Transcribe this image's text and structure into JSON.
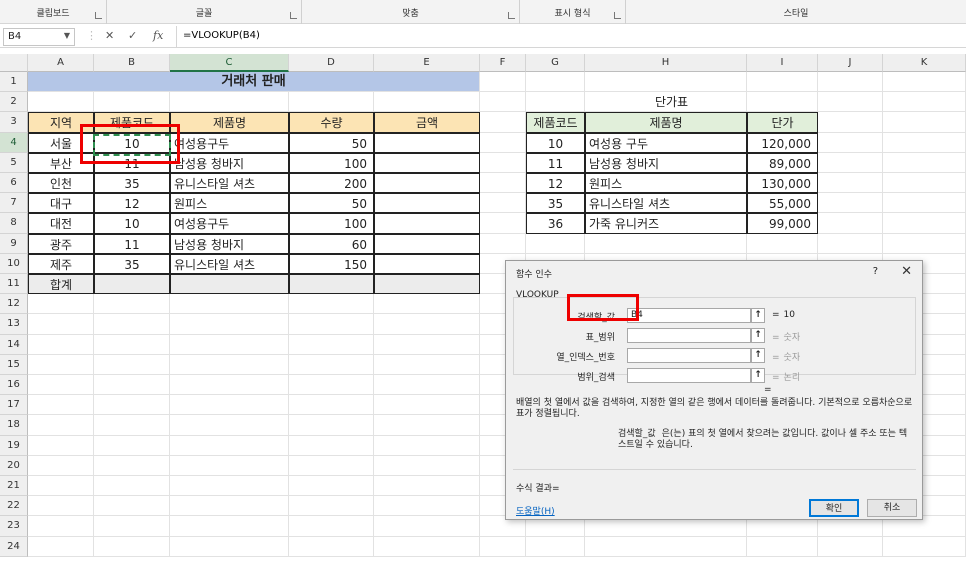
{
  "ribbon": {
    "groups": [
      "클립보드",
      "글꼴",
      "맞춤",
      "표시 형식",
      "스타일"
    ]
  },
  "formula_bar": {
    "name_box": "B4",
    "cancel": "✕",
    "enter": "✓",
    "fx": "fx",
    "formula": "=VLOOKUP(B4)"
  },
  "columns": [
    "A",
    "B",
    "C",
    "D",
    "E",
    "F",
    "G",
    "H",
    "I",
    "J",
    "K"
  ],
  "rows": [
    "1",
    "2",
    "3",
    "4",
    "5",
    "6",
    "7",
    "8",
    "9",
    "10",
    "11",
    "12",
    "13",
    "14",
    "15",
    "16",
    "17",
    "18",
    "19",
    "20",
    "21",
    "22",
    "23",
    "24"
  ],
  "sheet": {
    "title": "거래처 판매",
    "headers": [
      "지역",
      "제품코드",
      "제품명",
      "수량",
      "금액"
    ],
    "data": [
      {
        "region": "서울",
        "code": "10",
        "name": "여성용구두",
        "qty": "50"
      },
      {
        "region": "부산",
        "code": "11",
        "name": "남성용 청바지",
        "qty": "100"
      },
      {
        "region": "인천",
        "code": "35",
        "name": "유니스타일 셔츠",
        "qty": "200"
      },
      {
        "region": "대구",
        "code": "12",
        "name": "원피스",
        "qty": "50"
      },
      {
        "region": "대전",
        "code": "10",
        "name": "여성용구두",
        "qty": "100"
      },
      {
        "region": "광주",
        "code": "11",
        "name": "남성용 청바지",
        "qty": "60"
      },
      {
        "region": "제주",
        "code": "35",
        "name": "유니스타일 셔츠",
        "qty": "150"
      }
    ],
    "total_label": "합계"
  },
  "price_table": {
    "title": "단가표",
    "headers": [
      "제품코드",
      "제품명",
      "단가"
    ],
    "data": [
      {
        "code": "10",
        "name": "여성용 구두",
        "price": "120,000"
      },
      {
        "code": "11",
        "name": "남성용 청바지",
        "price": "89,000"
      },
      {
        "code": "12",
        "name": "원피스",
        "price": "130,000"
      },
      {
        "code": "35",
        "name": "유니스타일 셔츠",
        "price": "55,000"
      },
      {
        "code": "36",
        "name": "가죽 유니커즈",
        "price": "99,000"
      }
    ]
  },
  "dialog": {
    "title": "함수 인수",
    "help_glyph": "?",
    "close_glyph": "✕",
    "function_name": "VLOOKUP",
    "args": [
      {
        "label": "검색할_값",
        "value": "B4",
        "result": "10"
      },
      {
        "label": "표_범위",
        "value": "",
        "result": "숫자"
      },
      {
        "label": "열_인덱스_번호",
        "value": "",
        "result": "숫자"
      },
      {
        "label": "범위_검색",
        "value": "",
        "result": "논리"
      }
    ],
    "ref_button": "↑",
    "eq_sign": "=",
    "description": "배열의 첫 열에서 값을 검색하여, 지정한 열의 같은 행에서 데이터를 돌려줍니다. 기본적으로 오름차순으로 표가 정렬됩니다.",
    "arg_name": "검색할_값",
    "arg_desc": "은(는) 표의 첫 열에서 찾으려는 값입니다. 값이나 셀 주소 또는 텍스트일 수 있습니다.",
    "formula_result": "수식 결과=",
    "help_link": "도움말(H)",
    "ok": "확인",
    "cancel": "취소"
  }
}
